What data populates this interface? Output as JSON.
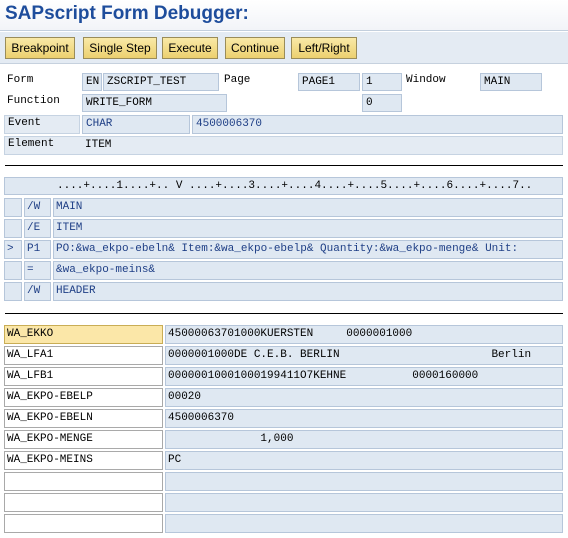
{
  "title": "SAPscript Form Debugger:",
  "toolbar": {
    "breakpoint": "Breakpoint",
    "single_step": "Single Step",
    "execute": "Execute",
    "continue": "Continue",
    "left_right": "Left/Right"
  },
  "header": {
    "form_label": "Form",
    "form_lang": "EN",
    "form_name": "ZSCRIPT_TEST",
    "page_label": "Page",
    "page_name": "PAGE1",
    "page_num": "1",
    "window_label": "Window",
    "window_name": "MAIN",
    "function_label": "Function",
    "function_name": "WRITE_FORM",
    "function_value": "0",
    "event_label": "Event",
    "event_type": "CHAR",
    "event_value": "4500006370",
    "element_label": "Element",
    "element_name": "ITEM"
  },
  "source": {
    "ruler": "....+....1....+.. V ....+....3....+....4....+....5....+....6....+....7..",
    "lines": [
      {
        "marker": "",
        "tag": "/W",
        "text": "MAIN"
      },
      {
        "marker": "",
        "tag": "/E",
        "text": "ITEM"
      },
      {
        "marker": ">",
        "tag": "P1",
        "text": "PO:&wa_ekpo-ebeln& Item:&wa_ekpo-ebelp& Quantity:&wa_ekpo-menge& Unit:"
      },
      {
        "marker": "",
        "tag": "=",
        "text": "&wa_ekpo-meins&"
      },
      {
        "marker": "",
        "tag": "/W",
        "text": "HEADER"
      }
    ]
  },
  "variables": {
    "rows": [
      {
        "name": "WA_EKKO",
        "value": "45000063701000KUERSTEN     0000001000"
      },
      {
        "name": "WA_LFA1",
        "value": "0000001000DE C.E.B. BERLIN                       Berlin"
      },
      {
        "name": "WA_LFB1",
        "value": "00000010001000199411O7KEHNE          0000160000"
      },
      {
        "name": "WA_EKPO-EBELP",
        "value": "00020"
      },
      {
        "name": "WA_EKPO-EBELN",
        "value": "4500006370"
      },
      {
        "name": "WA_EKPO-MENGE",
        "value": "              1,000"
      },
      {
        "name": "WA_EKPO-MEINS",
        "value": "PC"
      },
      {
        "name": "",
        "value": ""
      },
      {
        "name": "",
        "value": ""
      },
      {
        "name": "",
        "value": ""
      }
    ]
  }
}
